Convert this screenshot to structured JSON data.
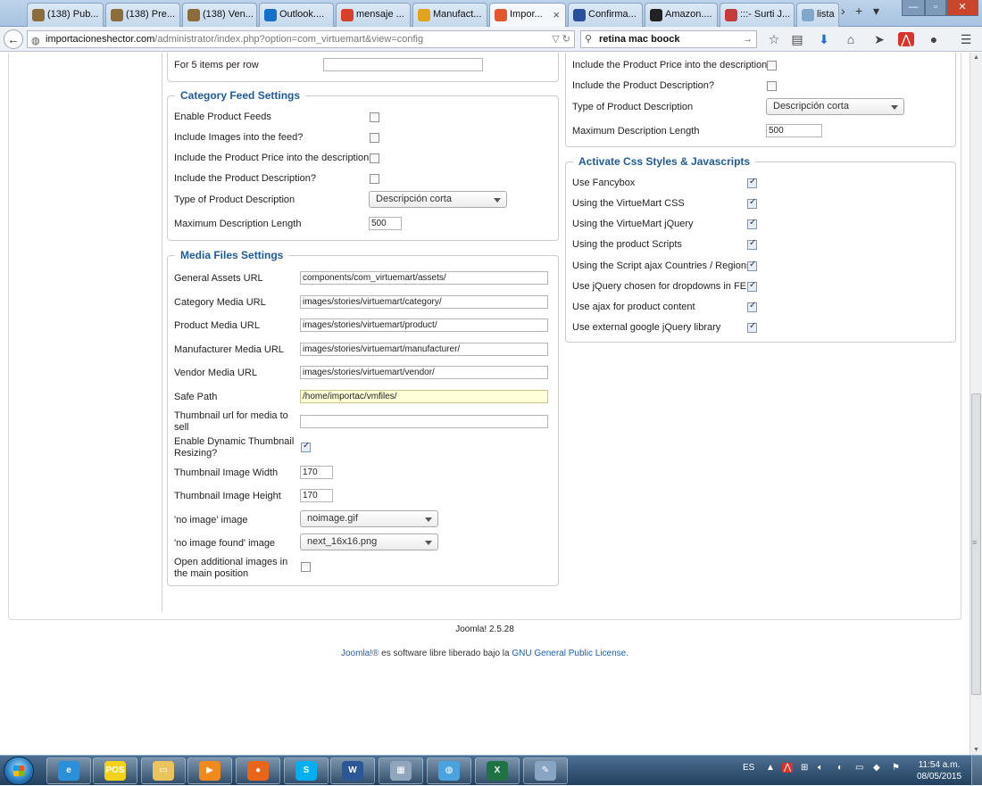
{
  "browser": {
    "tabs": [
      {
        "label": "(138) Pub...",
        "icon": "reddit-alien-icon",
        "color": "#8a6d3b"
      },
      {
        "label": "(138) Pre...",
        "icon": "reddit-alien-icon",
        "color": "#8a6d3b"
      },
      {
        "label": "(138) Ven...",
        "icon": "reddit-alien-icon",
        "color": "#8a6d3b"
      },
      {
        "label": "Outlook....",
        "icon": "outlook-icon",
        "color": "#1470c8"
      },
      {
        "label": "mensaje ...",
        "icon": "web-icon",
        "color": "#d8402a"
      },
      {
        "label": "Manufact...",
        "icon": "virtuemart-icon",
        "color": "#e0a51c"
      },
      {
        "label": "Impor...",
        "icon": "joomla-icon",
        "color": "#e4562d",
        "active": true
      },
      {
        "label": "Confirma...",
        "icon": "h-icon",
        "color": "#2a4f9a"
      },
      {
        "label": "Amazon....",
        "icon": "amazon-icon",
        "color": "#222222"
      },
      {
        "label": ":::- Surti J...",
        "icon": "grid-icon",
        "color": "#c33b3b"
      },
      {
        "label": "lista",
        "icon": "question-icon",
        "color": "#7fa8cc"
      }
    ],
    "url_host": "importacioneshector.com",
    "url_path": "/administrator/index.php?option=com_virtuemart&view=config",
    "search_value": "retina mac boock"
  },
  "page": {
    "top_left_row_label": "For 5 items per row",
    "category_feed": {
      "legend": "Category Feed Settings",
      "enable_feeds": "Enable Product Feeds",
      "include_images": "Include Images into the feed?",
      "include_price": "Include the Product Price into the description?",
      "include_description": "Include the Product Description?",
      "desc_type_label": "Type of Product Description",
      "desc_type_value": "Descripción corta",
      "max_len_label": "Maximum Description Length",
      "max_len_value": "500"
    },
    "right_top": {
      "include_price": "Include the Product Price into the description?",
      "include_description": "Include the Product Description?",
      "desc_type_label": "Type of Product Description",
      "desc_type_value": "Descripción corta",
      "max_len_label": "Maximum Description Length",
      "max_len_value": "500"
    },
    "css_js": {
      "legend": "Activate Css Styles & Javascripts",
      "items": [
        "Use Fancybox",
        "Using the VirtueMart CSS",
        "Using the VirtueMart jQuery",
        "Using the product Scripts",
        "Using the Script ajax Countries / Regions",
        "Use jQuery chosen for dropdowns in FE",
        "Use ajax for product content",
        "Use external google jQuery library"
      ]
    },
    "media": {
      "legend": "Media Files Settings",
      "general_assets_label": "General Assets URL",
      "general_assets_value": "components/com_virtuemart/assets/",
      "category_media_label": "Category Media URL",
      "category_media_value": "images/stories/virtuemart/category/",
      "product_media_label": "Product Media URL",
      "product_media_value": "images/stories/virtuemart/product/",
      "manufacturer_media_label": "Manufacturer Media URL",
      "manufacturer_media_value": "images/stories/virtuemart/manufacturer/",
      "vendor_media_label": "Vendor Media URL",
      "vendor_media_value": "images/stories/virtuemart/vendor/",
      "safe_path_label": "Safe Path",
      "safe_path_value": "/home/importac/vmfiles/",
      "thumb_sell_label_1": "Thumbnail url for media to",
      "thumb_sell_label_2": "sell",
      "thumb_sell_value": "",
      "dyn_thumb_label_1": "Enable Dynamic Thumbnail",
      "dyn_thumb_label_2": "Resizing?",
      "thumb_width_label": "Thumbnail Image Width",
      "thumb_width_value": "170",
      "thumb_height_label": "Thumbnail Image Height",
      "thumb_height_value": "170",
      "no_image_label": "'no image' image",
      "no_image_value": "noimage.gif",
      "no_image_found_label": "'no image found' image",
      "no_image_found_value": "next_16x16.png",
      "open_additional_label_1": "Open additional images in",
      "open_additional_label_2": "the main position"
    },
    "footer_version": "Joomla! 2.5.28",
    "footer_link1": "Joomla!®",
    "footer_text": " es software libre liberado bajo la ",
    "footer_link2": "GNU General Public License."
  },
  "taskbar": {
    "apps": [
      {
        "name": "internet-explorer-icon",
        "glyph": "e",
        "color": "#2b8fd9"
      },
      {
        "name": "pos-icon",
        "glyph": "POS",
        "color": "#f2d21b"
      },
      {
        "name": "explorer-folder-icon",
        "glyph": "▭",
        "color": "#e9c45d"
      },
      {
        "name": "media-player-icon",
        "glyph": "▶",
        "color": "#f08a1c"
      },
      {
        "name": "firefox-icon",
        "glyph": "●",
        "color": "#e8651a"
      },
      {
        "name": "skype-icon",
        "glyph": "S",
        "color": "#00aff0"
      },
      {
        "name": "word-icon",
        "glyph": "W",
        "color": "#2b5797"
      },
      {
        "name": "calculator-icon",
        "glyph": "▦",
        "color": "#8fa6bc"
      },
      {
        "name": "network-icon",
        "glyph": "◍",
        "color": "#4aa3df"
      },
      {
        "name": "excel-icon",
        "glyph": "X",
        "color": "#1f7244"
      },
      {
        "name": "paint-icon",
        "glyph": "✎",
        "color": "#8aa5c4"
      }
    ],
    "lang": "ES",
    "time": "11:54 a.m.",
    "date": "08/05/2015"
  }
}
